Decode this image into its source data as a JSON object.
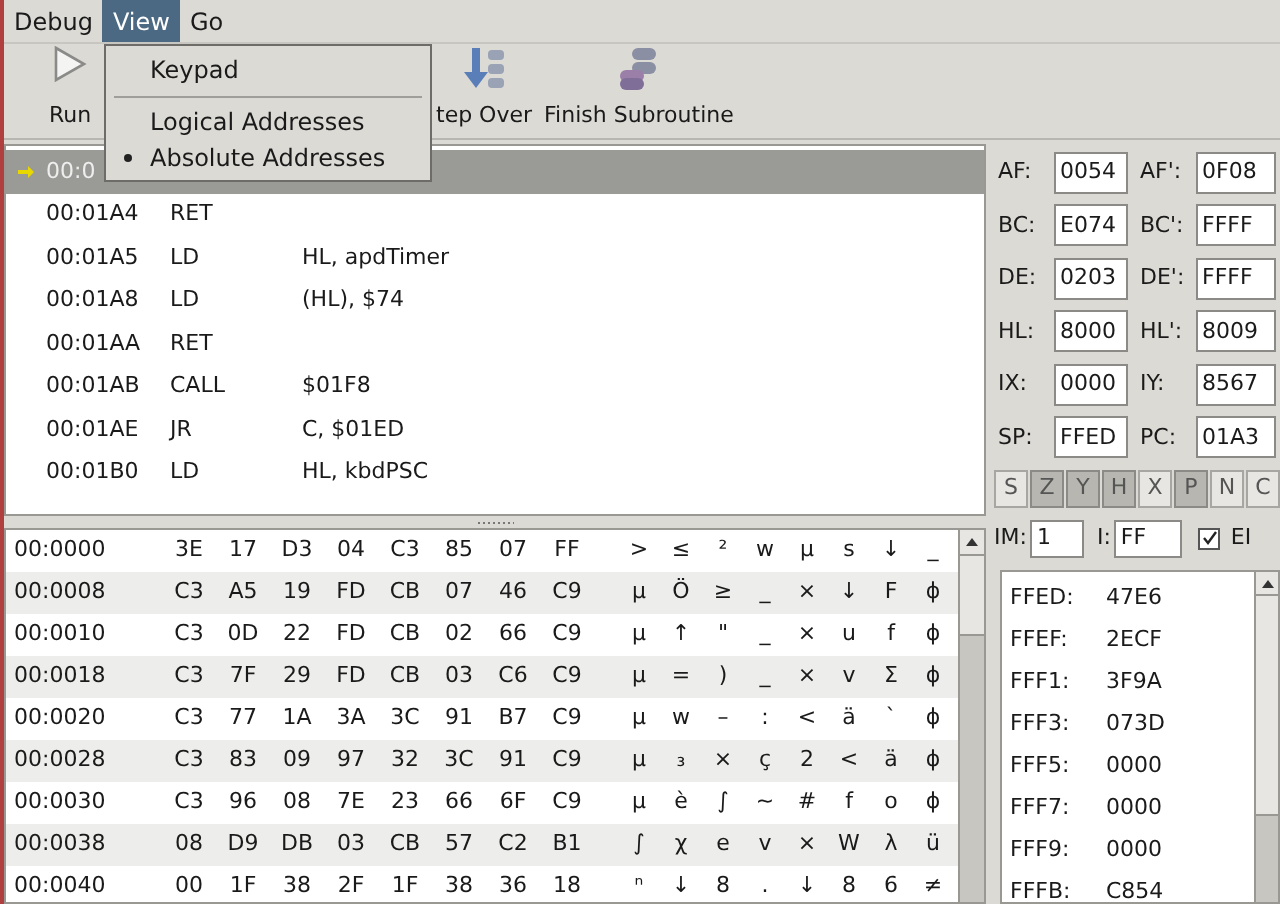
{
  "menubar": [
    {
      "label": "Debug",
      "selected": false
    },
    {
      "label": "View",
      "selected": true
    },
    {
      "label": "Go",
      "selected": false
    }
  ],
  "view_menu": [
    {
      "kind": "item",
      "label": "Keypad"
    },
    {
      "kind": "separator"
    },
    {
      "kind": "radio",
      "label": "Logical Addresses",
      "selected": false
    },
    {
      "kind": "radio",
      "label": "Absolute Addresses",
      "selected": true
    }
  ],
  "toolbar": [
    {
      "label": "Run",
      "kind": "play"
    },
    {
      "label": "tep Over",
      "kind": "step"
    },
    {
      "label": "Finish Subroutine",
      "kind": "finish"
    }
  ],
  "disassembly": [
    {
      "address": "00:0",
      "current": true
    },
    {
      "address": "00:01A4",
      "op": "RET",
      "current": false
    },
    {
      "address": "00:01A5",
      "op": "LD",
      "args": "HL, apdTimer",
      "current": false
    },
    {
      "address": "00:01A8",
      "op": "LD",
      "args": "(HL), $74",
      "current": false
    },
    {
      "address": "00:01AA",
      "op": "RET",
      "current": false
    },
    {
      "address": "00:01AB",
      "op": "CALL",
      "args": "$01F8",
      "current": false
    },
    {
      "address": "00:01AE",
      "op": "JR",
      "args": "C, $01ED",
      "current": false
    },
    {
      "address": "00:01B0",
      "op": "LD",
      "args": "HL, kbdPSC",
      "current": false
    }
  ],
  "memory": [
    {
      "address": "00:0000",
      "bytes": [
        "3E",
        "17",
        "D3",
        "04",
        "C3",
        "85",
        "07",
        "FF"
      ],
      "chars": [
        ">",
        "≤",
        "²",
        "w",
        "µ",
        "s",
        "↓",
        "_"
      ]
    },
    {
      "address": "00:0008",
      "bytes": [
        "C3",
        "A5",
        "19",
        "FD",
        "CB",
        "07",
        "46",
        "C9"
      ],
      "chars": [
        "µ",
        "Ö",
        "≥",
        "_",
        "×",
        "↓",
        "F",
        "ϕ"
      ]
    },
    {
      "address": "00:0010",
      "bytes": [
        "C3",
        "0D",
        "22",
        "FD",
        "CB",
        "02",
        "66",
        "C9"
      ],
      "chars": [
        "µ",
        "↑",
        "\"",
        "_",
        "×",
        "u",
        "f",
        "ϕ"
      ]
    },
    {
      "address": "00:0018",
      "bytes": [
        "C3",
        "7F",
        "29",
        "FD",
        "CB",
        "03",
        "C6",
        "C9"
      ],
      "chars": [
        "µ",
        "=",
        ")",
        "_",
        "×",
        "v",
        "Σ",
        "ϕ"
      ]
    },
    {
      "address": "00:0020",
      "bytes": [
        "C3",
        "77",
        "1A",
        "3A",
        "3C",
        "91",
        "B7",
        "C9"
      ],
      "chars": [
        "µ",
        "w",
        "–",
        ":",
        "<",
        "ä",
        "`",
        "ϕ"
      ]
    },
    {
      "address": "00:0028",
      "bytes": [
        "C3",
        "83",
        "09",
        "97",
        "32",
        "3C",
        "91",
        "C9"
      ],
      "chars": [
        "µ",
        "₃",
        "×",
        "ç",
        "2",
        "<",
        "ä",
        "ϕ"
      ]
    },
    {
      "address": "00:0030",
      "bytes": [
        "C3",
        "96",
        "08",
        "7E",
        "23",
        "66",
        "6F",
        "C9"
      ],
      "chars": [
        "µ",
        "è",
        "∫",
        "~",
        "#",
        "f",
        "o",
        "ϕ"
      ]
    },
    {
      "address": "00:0038",
      "bytes": [
        "08",
        "D9",
        "DB",
        "03",
        "CB",
        "57",
        "C2",
        "B1"
      ],
      "chars": [
        "∫",
        "χ",
        "e",
        "v",
        "×",
        "W",
        "λ",
        "ü"
      ]
    },
    {
      "address": "00:0040",
      "bytes": [
        "00",
        "1F",
        "38",
        "2F",
        "1F",
        "38",
        "36",
        "18"
      ],
      "chars": [
        "ⁿ",
        "↓",
        "8",
        ".",
        "↓",
        "8",
        "6",
        "≠"
      ]
    }
  ],
  "registers": [
    {
      "label": "AF:",
      "value": "0054",
      "label2": "AF':",
      "value2": "0F08"
    },
    {
      "label": "BC:",
      "value": "E074",
      "label2": "BC':",
      "value2": "FFFF"
    },
    {
      "label": "DE:",
      "value": "0203",
      "label2": "DE':",
      "value2": "FFFF"
    },
    {
      "label": "HL:",
      "value": "8000",
      "label2": "HL':",
      "value2": "8009"
    },
    {
      "label": "IX:",
      "value": "0000",
      "label2": "IY:",
      "value2": "8567"
    },
    {
      "label": "SP:",
      "value": "FFED",
      "label2": "PC:",
      "value2": "01A3"
    }
  ],
  "flags": [
    {
      "label": "S",
      "on": false
    },
    {
      "label": "Z",
      "on": true
    },
    {
      "label": "Y",
      "on": true
    },
    {
      "label": "H",
      "on": true
    },
    {
      "label": "X",
      "on": false
    },
    {
      "label": "P",
      "on": true
    },
    {
      "label": "N",
      "on": false
    },
    {
      "label": "C",
      "on": false
    }
  ],
  "interrupts": {
    "im_label": "IM:",
    "im": "1",
    "i_label": "I:",
    "i": "FF",
    "ei_label": "EI",
    "ei_checked": true
  },
  "stack": [
    {
      "address": "FFED:",
      "value": "47E6"
    },
    {
      "address": "FFEF:",
      "value": "2ECF"
    },
    {
      "address": "FFF1:",
      "value": "3F9A"
    },
    {
      "address": "FFF3:",
      "value": "073D"
    },
    {
      "address": "FFF5:",
      "value": "0000"
    },
    {
      "address": "FFF7:",
      "value": "0000"
    },
    {
      "address": "FFF9:",
      "value": "0000"
    },
    {
      "address": "FFFB:",
      "value": "C854"
    }
  ]
}
